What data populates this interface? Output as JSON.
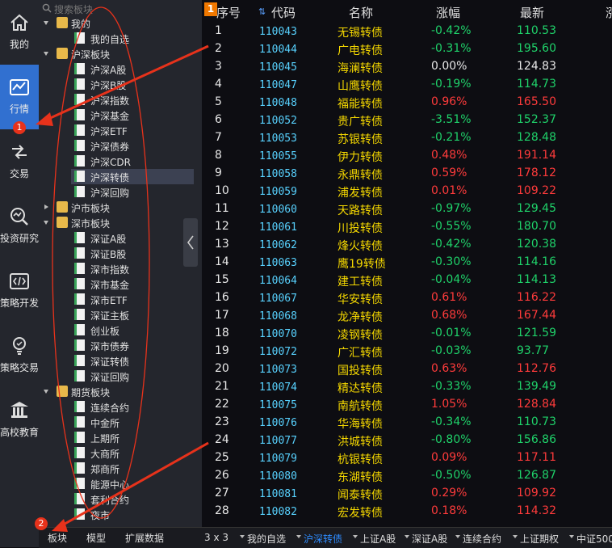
{
  "nav": [
    {
      "label": "我的",
      "icon": "home-icon"
    },
    {
      "label": "行情",
      "icon": "chart-icon"
    },
    {
      "label": "交易",
      "icon": "exchange-icon"
    },
    {
      "label": "投资研究",
      "icon": "research-icon"
    },
    {
      "label": "策略开发",
      "icon": "code-icon"
    },
    {
      "label": "策略交易",
      "icon": "bulb-icon"
    },
    {
      "label": "高校教育",
      "icon": "education-icon"
    }
  ],
  "search": {
    "placeholder": "搜索板块"
  },
  "tree": [
    {
      "label": "我的",
      "level": 0,
      "expanded": true
    },
    {
      "label": "我的自选",
      "level": 1
    },
    {
      "label": "沪深板块",
      "level": 0,
      "expanded": true
    },
    {
      "label": "沪深A股",
      "level": 1
    },
    {
      "label": "沪深B股",
      "level": 1
    },
    {
      "label": "沪深指数",
      "level": 1
    },
    {
      "label": "沪深基金",
      "level": 1
    },
    {
      "label": "沪深ETF",
      "level": 1
    },
    {
      "label": "沪深债券",
      "level": 1
    },
    {
      "label": "沪深CDR",
      "level": 1
    },
    {
      "label": "沪深转债",
      "level": 1,
      "selected": true
    },
    {
      "label": "沪深回购",
      "level": 1
    },
    {
      "label": "沪市板块",
      "level": 0,
      "expanded": false
    },
    {
      "label": "深市板块",
      "level": 0,
      "expanded": true
    },
    {
      "label": "深证A股",
      "level": 1
    },
    {
      "label": "深证B股",
      "level": 1
    },
    {
      "label": "深市指数",
      "level": 1
    },
    {
      "label": "深市基金",
      "level": 1
    },
    {
      "label": "深市ETF",
      "level": 1
    },
    {
      "label": "深证主板",
      "level": 1
    },
    {
      "label": "创业板",
      "level": 1
    },
    {
      "label": "深市债券",
      "level": 1
    },
    {
      "label": "深证转债",
      "level": 1
    },
    {
      "label": "深证回购",
      "level": 1
    },
    {
      "label": "期货板块",
      "level": 0,
      "expanded": true
    },
    {
      "label": "连续合约",
      "level": 1
    },
    {
      "label": "中金所",
      "level": 1
    },
    {
      "label": "上期所",
      "level": 1
    },
    {
      "label": "大商所",
      "level": 1
    },
    {
      "label": "郑商所",
      "level": 1
    },
    {
      "label": "能源中心",
      "level": 1
    },
    {
      "label": "套利合约",
      "level": 1
    },
    {
      "label": "夜市",
      "level": 1
    }
  ],
  "left_tabs": [
    "板块",
    "模型",
    "扩展数据"
  ],
  "table": {
    "headers": [
      "序号",
      "代码",
      "名称",
      "涨幅",
      "最新",
      "涨"
    ],
    "rows": [
      [
        "1",
        "110043",
        "无锡转债",
        "-0.42%",
        "110.53"
      ],
      [
        "2",
        "110044",
        "广电转债",
        "-0.31%",
        "195.60"
      ],
      [
        "3",
        "110045",
        "海澜转债",
        "0.00%",
        "124.83"
      ],
      [
        "4",
        "110047",
        "山鹰转债",
        "-0.19%",
        "114.73"
      ],
      [
        "5",
        "110048",
        "福能转债",
        "0.96%",
        "165.50"
      ],
      [
        "6",
        "110052",
        "贵广转债",
        "-3.51%",
        "152.37"
      ],
      [
        "7",
        "110053",
        "苏银转债",
        "-0.21%",
        "128.48"
      ],
      [
        "8",
        "110055",
        "伊力转债",
        "0.48%",
        "191.14"
      ],
      [
        "9",
        "110058",
        "永鼎转债",
        "0.59%",
        "178.12"
      ],
      [
        "10",
        "110059",
        "浦发转债",
        "0.01%",
        "109.22"
      ],
      [
        "11",
        "110060",
        "天路转债",
        "-0.97%",
        "129.45"
      ],
      [
        "12",
        "110061",
        "川投转债",
        "-0.55%",
        "180.70"
      ],
      [
        "13",
        "110062",
        "烽火转债",
        "-0.42%",
        "120.38"
      ],
      [
        "14",
        "110063",
        "鹰19转债",
        "-0.30%",
        "114.16"
      ],
      [
        "15",
        "110064",
        "建工转债",
        "-0.04%",
        "114.13"
      ],
      [
        "16",
        "110067",
        "华安转债",
        "0.61%",
        "116.22"
      ],
      [
        "17",
        "110068",
        "龙净转债",
        "0.68%",
        "167.44"
      ],
      [
        "18",
        "110070",
        "凌钢转债",
        "-0.01%",
        "121.59"
      ],
      [
        "19",
        "110072",
        "广汇转债",
        "-0.03%",
        "93.77"
      ],
      [
        "20",
        "110073",
        "国投转债",
        "0.63%",
        "112.76"
      ],
      [
        "21",
        "110074",
        "精达转债",
        "-0.33%",
        "139.49"
      ],
      [
        "22",
        "110075",
        "南航转债",
        "1.05%",
        "128.84"
      ],
      [
        "23",
        "110076",
        "华海转债",
        "-0.34%",
        "110.73"
      ],
      [
        "24",
        "110077",
        "洪城转债",
        "-0.80%",
        "156.86"
      ],
      [
        "25",
        "110079",
        "杭银转债",
        "0.09%",
        "117.11"
      ],
      [
        "26",
        "110080",
        "东湖转债",
        "-0.50%",
        "126.87"
      ],
      [
        "27",
        "110081",
        "闻泰转债",
        "0.29%",
        "109.92"
      ],
      [
        "28",
        "110082",
        "宏发转债",
        "0.18%",
        "114.32"
      ]
    ]
  },
  "bottom_tabs": {
    "grid": "3 x 3",
    "items": [
      "我的自选",
      "沪深转债",
      "上证A股",
      "深证A股",
      "连续合约",
      "上证期权",
      "中证500"
    ],
    "active": "沪深转债"
  },
  "badges": [
    "1",
    "2",
    "1"
  ],
  "colors": {
    "up": "#ff3b3b",
    "down": "#1fd26a",
    "code": "#58d2ff",
    "name": "#f5d800",
    "accent": "#3170d0",
    "annotation": "#e7321b"
  }
}
